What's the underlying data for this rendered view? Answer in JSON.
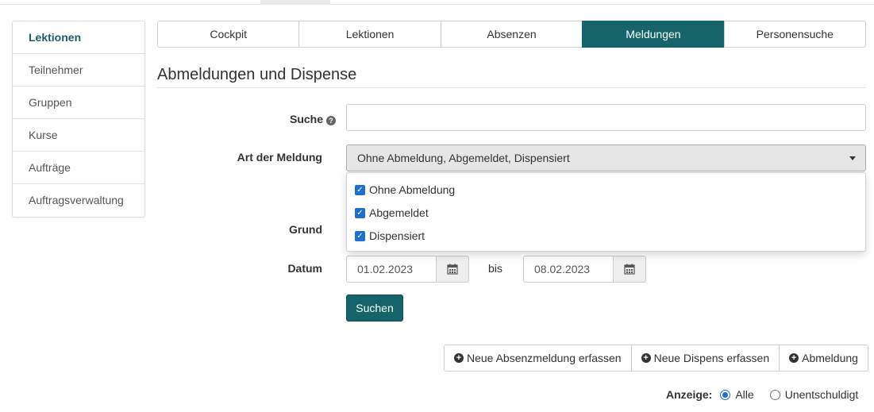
{
  "sidebar": {
    "items": [
      {
        "label": "Lektionen",
        "active": true
      },
      {
        "label": "Teilnehmer",
        "active": false
      },
      {
        "label": "Gruppen",
        "active": false
      },
      {
        "label": "Kurse",
        "active": false
      },
      {
        "label": "Aufträge",
        "active": false
      },
      {
        "label": "Auftragsverwaltung",
        "active": false
      }
    ]
  },
  "tabs": [
    {
      "label": "Cockpit"
    },
    {
      "label": "Lektionen"
    },
    {
      "label": "Absenzen"
    },
    {
      "label": "Meldungen",
      "active": true
    },
    {
      "label": "Personensuche"
    }
  ],
  "title": "Abmeldungen und Dispense",
  "form": {
    "search_label": "Suche",
    "search_value": "",
    "type_label": "Art der Meldung",
    "type_value": "Ohne Abmeldung, Abgemeldet, Dispensiert",
    "type_options": [
      {
        "label": "Ohne Abmeldung",
        "checked": true
      },
      {
        "label": "Abgemeldet",
        "checked": true
      },
      {
        "label": "Dispensiert",
        "checked": true
      }
    ],
    "reason_label": "Grund",
    "date_label": "Datum",
    "date_from": "01.02.2023",
    "date_sep": "bis",
    "date_to": "08.02.2023",
    "search_button": "Suchen"
  },
  "actions": {
    "new_absence": "Neue Absenzmeldung erfassen",
    "new_dispense": "Neue Dispens erfassen",
    "deregistration": "Abmeldung"
  },
  "filter": {
    "label": "Anzeige:",
    "options": [
      {
        "label": "Alle",
        "checked": true
      },
      {
        "label": "Unentschuldigt",
        "checked": false
      }
    ]
  },
  "colors": {
    "accent": "#15646b",
    "checkbox": "#1d6fd1"
  },
  "icons": {
    "help": "question-circle-icon",
    "calendar": "calendar-icon",
    "plus": "plus-circle-icon",
    "caret": "caret-down-icon"
  }
}
